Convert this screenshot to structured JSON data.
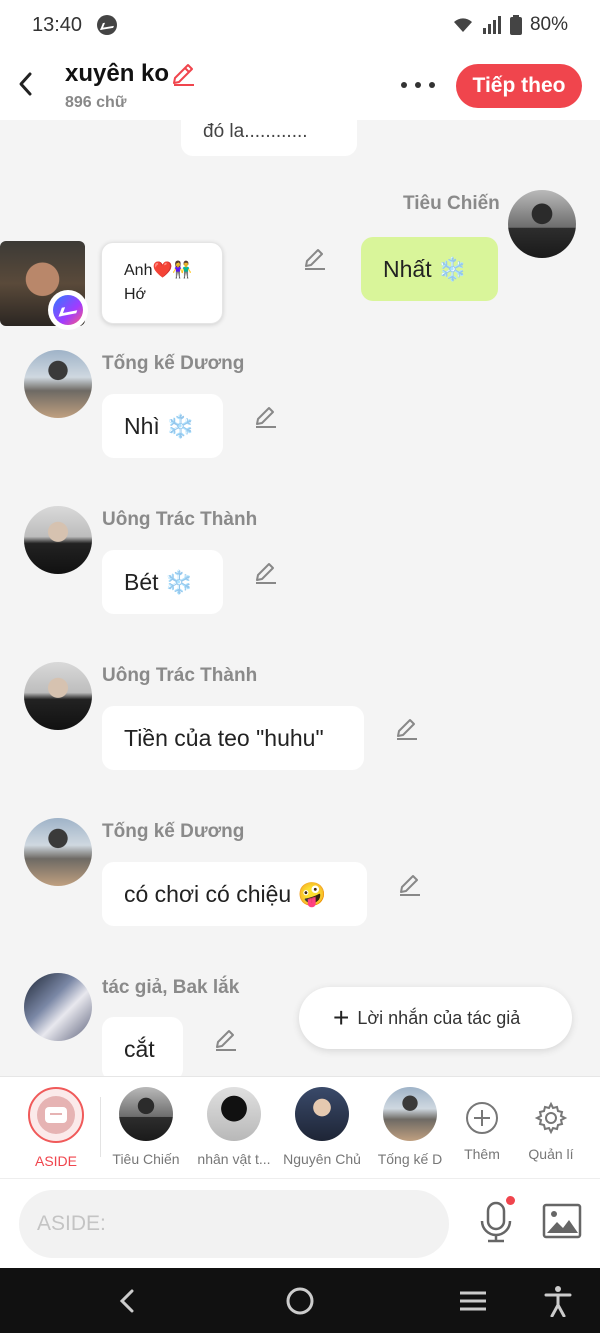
{
  "status_bar": {
    "time": "13:40",
    "battery": "80%"
  },
  "header": {
    "title": "xuyên ko",
    "subtitle": "896 chữ",
    "next_label": "Tiếp theo"
  },
  "messages": {
    "top_partial": "đó la............",
    "m1": {
      "sender": "Tiêu Chiến",
      "text": "Nhất ❄️"
    },
    "m2": {
      "line1": "Anh❤️👫",
      "line2": "Hớ"
    },
    "m3": {
      "sender": "Tống kế Dương",
      "text": "Nhì ❄️"
    },
    "m4": {
      "sender": "Uông Trác Thành",
      "text": "Bét ❄️"
    },
    "m5": {
      "sender": "Uông Trác Thành",
      "text": "Tiền của teo \"huhu\""
    },
    "m6": {
      "sender": "Tống kế Dương",
      "text": "có chơi có chiệu 🤪"
    },
    "m7": {
      "sender": "tác giả, Bak lắk",
      "text": "cắt"
    }
  },
  "fab": {
    "label": "Lời nhắn của tác giả"
  },
  "character_bar": {
    "aside": "ASIDE",
    "c1": "Tiêu Chiến",
    "c2": "nhân vật t...",
    "c3": "Nguyên Chủ",
    "c4": "Tống kế D",
    "add": "Thêm",
    "manage": "Quản lí"
  },
  "input": {
    "placeholder": "ASIDE:"
  },
  "colors": {
    "accent": "#f0454d",
    "highlight_bubble": "#d9f59a"
  }
}
